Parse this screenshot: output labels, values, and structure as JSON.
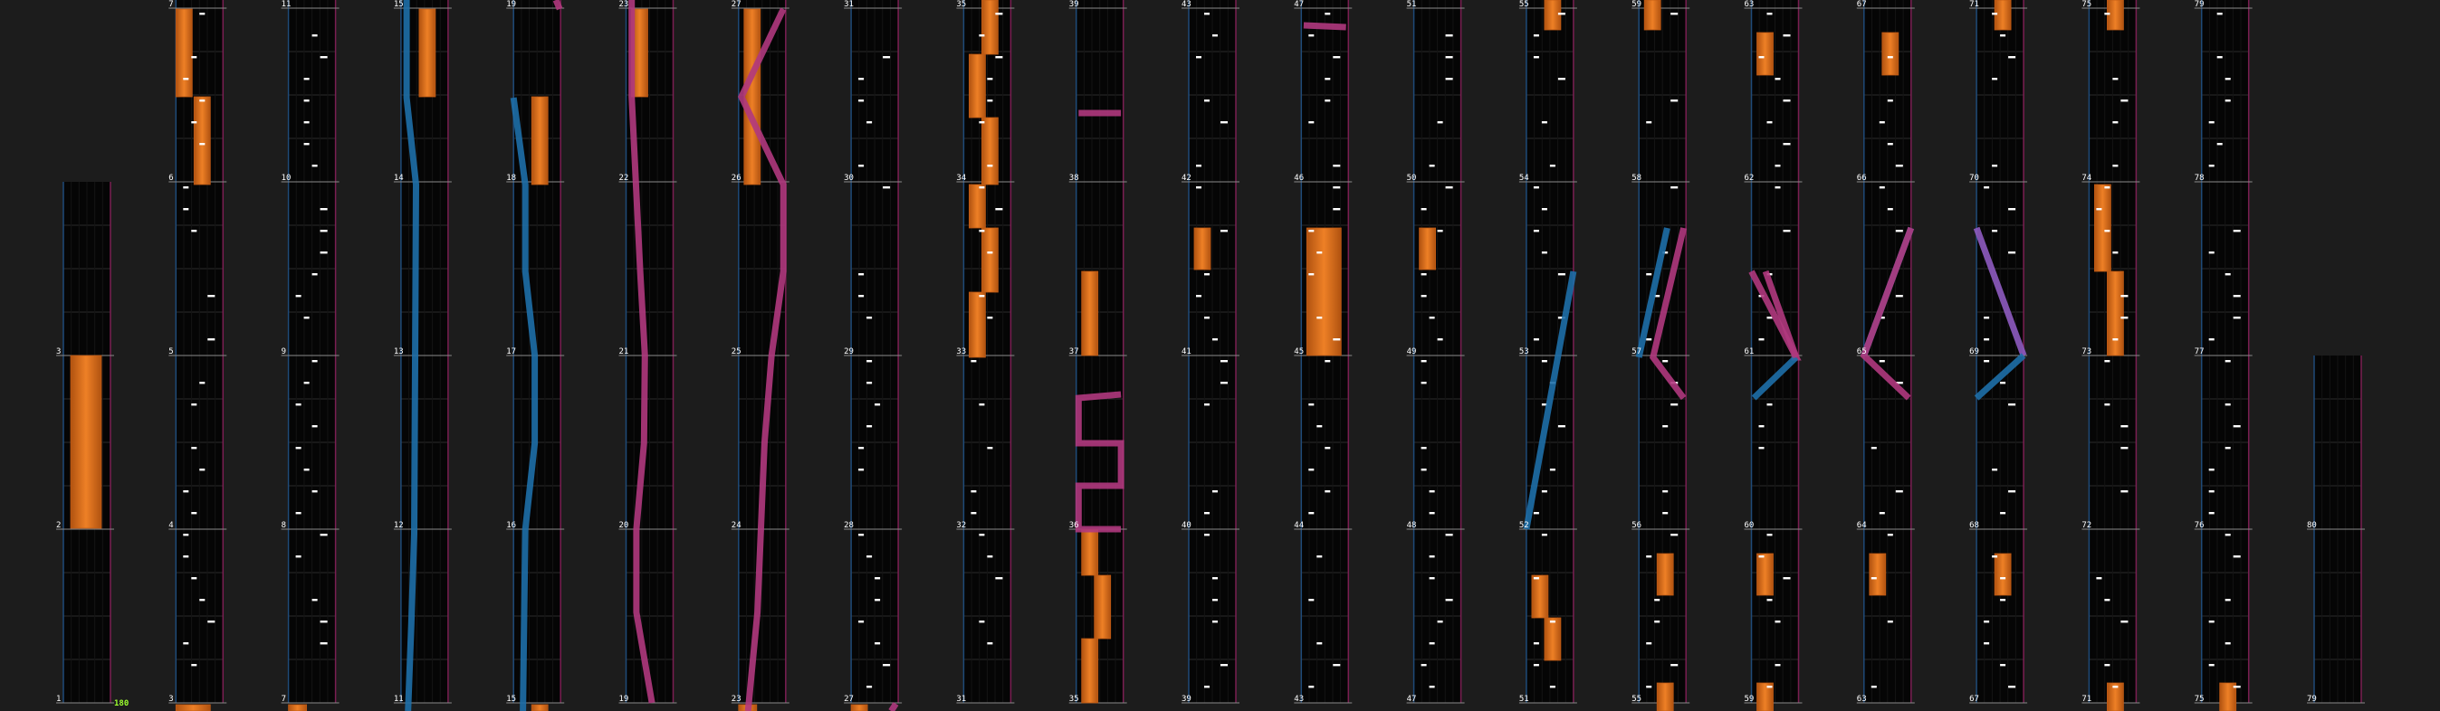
{
  "bpm_label": "180",
  "colors": {
    "background": "#1c1c1c",
    "lane_bg": "#050505",
    "lane_grid": "#2c2c2c",
    "left_edge": "#1e4a78",
    "right_edge": "#7a1e52",
    "measure_line": "#8a8a8a",
    "chip_note": "#ffffff",
    "hold_orange": "#e8741e",
    "laser_left": "#1e6fa8",
    "laser_right": "#b0387e",
    "bpm_text": "#9cff2e"
  },
  "measures": [
    {
      "n": 1,
      "col": 0,
      "row": 0
    },
    {
      "n": 2,
      "col": 0,
      "row": 1
    },
    {
      "n": 3,
      "col": 0,
      "row": 2
    },
    {
      "n": 3,
      "col": 1,
      "row": 0
    },
    {
      "n": 4,
      "col": 1,
      "row": 1
    },
    {
      "n": 5,
      "col": 1,
      "row": 2
    },
    {
      "n": 6,
      "col": 1,
      "row": 3
    },
    {
      "n": 7,
      "col": 1,
      "row": 4
    },
    {
      "n": 7,
      "col": 2,
      "row": 0
    },
    {
      "n": 8,
      "col": 2,
      "row": 1
    },
    {
      "n": 9,
      "col": 2,
      "row": 2
    },
    {
      "n": 10,
      "col": 2,
      "row": 3
    },
    {
      "n": 11,
      "col": 2,
      "row": 4
    },
    {
      "n": 11,
      "col": 3,
      "row": 0
    },
    {
      "n": 12,
      "col": 3,
      "row": 1
    },
    {
      "n": 13,
      "col": 3,
      "row": 2
    },
    {
      "n": 14,
      "col": 3,
      "row": 3
    },
    {
      "n": 15,
      "col": 3,
      "row": 4
    },
    {
      "n": 15,
      "col": 4,
      "row": 0
    },
    {
      "n": 16,
      "col": 4,
      "row": 1
    },
    {
      "n": 17,
      "col": 4,
      "row": 2
    },
    {
      "n": 18,
      "col": 4,
      "row": 3
    },
    {
      "n": 19,
      "col": 4,
      "row": 4
    },
    {
      "n": 19,
      "col": 5,
      "row": 0
    },
    {
      "n": 20,
      "col": 5,
      "row": 1
    },
    {
      "n": 21,
      "col": 5,
      "row": 2
    },
    {
      "n": 22,
      "col": 5,
      "row": 3
    },
    {
      "n": 23,
      "col": 5,
      "row": 4
    },
    {
      "n": 23,
      "col": 6,
      "row": 0
    },
    {
      "n": 24,
      "col": 6,
      "row": 1
    },
    {
      "n": 25,
      "col": 6,
      "row": 2
    },
    {
      "n": 26,
      "col": 6,
      "row": 3
    },
    {
      "n": 27,
      "col": 6,
      "row": 4
    },
    {
      "n": 27,
      "col": 7,
      "row": 0
    },
    {
      "n": 28,
      "col": 7,
      "row": 1
    },
    {
      "n": 29,
      "col": 7,
      "row": 2
    },
    {
      "n": 30,
      "col": 7,
      "row": 3
    },
    {
      "n": 31,
      "col": 7,
      "row": 4
    },
    {
      "n": 31,
      "col": 8,
      "row": 0
    },
    {
      "n": 32,
      "col": 8,
      "row": 1
    },
    {
      "n": 33,
      "col": 8,
      "row": 2
    },
    {
      "n": 34,
      "col": 8,
      "row": 3
    },
    {
      "n": 35,
      "col": 8,
      "row": 4
    },
    {
      "n": 35,
      "col": 9,
      "row": 0
    },
    {
      "n": 36,
      "col": 9,
      "row": 1
    },
    {
      "n": 37,
      "col": 9,
      "row": 2
    },
    {
      "n": 38,
      "col": 9,
      "row": 3
    },
    {
      "n": 39,
      "col": 9,
      "row": 4
    },
    {
      "n": 39,
      "col": 10,
      "row": 0
    },
    {
      "n": 40,
      "col": 10,
      "row": 1
    },
    {
      "n": 41,
      "col": 10,
      "row": 2
    },
    {
      "n": 42,
      "col": 10,
      "row": 3
    },
    {
      "n": 43,
      "col": 10,
      "row": 4
    },
    {
      "n": 43,
      "col": 11,
      "row": 0
    },
    {
      "n": 44,
      "col": 11,
      "row": 1
    },
    {
      "n": 45,
      "col": 11,
      "row": 2
    },
    {
      "n": 46,
      "col": 11,
      "row": 3
    },
    {
      "n": 47,
      "col": 11,
      "row": 4
    },
    {
      "n": 47,
      "col": 12,
      "row": 0
    },
    {
      "n": 48,
      "col": 12,
      "row": 1
    },
    {
      "n": 49,
      "col": 12,
      "row": 2
    },
    {
      "n": 50,
      "col": 12,
      "row": 3
    },
    {
      "n": 51,
      "col": 12,
      "row": 4
    },
    {
      "n": 51,
      "col": 13,
      "row": 0
    },
    {
      "n": 52,
      "col": 13,
      "row": 1
    },
    {
      "n": 53,
      "col": 13,
      "row": 2
    },
    {
      "n": 54,
      "col": 13,
      "row": 3
    },
    {
      "n": 55,
      "col": 13,
      "row": 4
    },
    {
      "n": 55,
      "col": 14,
      "row": 0
    },
    {
      "n": 56,
      "col": 14,
      "row": 1
    },
    {
      "n": 57,
      "col": 14,
      "row": 2
    },
    {
      "n": 58,
      "col": 14,
      "row": 3
    },
    {
      "n": 59,
      "col": 14,
      "row": 4
    },
    {
      "n": 59,
      "col": 15,
      "row": 0
    },
    {
      "n": 60,
      "col": 15,
      "row": 1
    },
    {
      "n": 61,
      "col": 15,
      "row": 2
    },
    {
      "n": 62,
      "col": 15,
      "row": 3
    },
    {
      "n": 63,
      "col": 15,
      "row": 4
    },
    {
      "n": 63,
      "col": 16,
      "row": 0
    },
    {
      "n": 64,
      "col": 16,
      "row": 1
    },
    {
      "n": 65,
      "col": 16,
      "row": 2
    },
    {
      "n": 66,
      "col": 16,
      "row": 3
    },
    {
      "n": 67,
      "col": 16,
      "row": 4
    },
    {
      "n": 67,
      "col": 17,
      "row": 0
    },
    {
      "n": 68,
      "col": 17,
      "row": 1
    },
    {
      "n": 69,
      "col": 17,
      "row": 2
    },
    {
      "n": 70,
      "col": 17,
      "row": 3
    },
    {
      "n": 71,
      "col": 17,
      "row": 4
    },
    {
      "n": 71,
      "col": 18,
      "row": 0
    },
    {
      "n": 72,
      "col": 18,
      "row": 1
    },
    {
      "n": 73,
      "col": 18,
      "row": 2
    },
    {
      "n": 74,
      "col": 18,
      "row": 3
    },
    {
      "n": 75,
      "col": 18,
      "row": 4
    },
    {
      "n": 75,
      "col": 19,
      "row": 0
    },
    {
      "n": 76,
      "col": 19,
      "row": 1
    },
    {
      "n": 77,
      "col": 19,
      "row": 2
    },
    {
      "n": 78,
      "col": 19,
      "row": 3
    },
    {
      "n": 79,
      "col": 19,
      "row": 4
    },
    {
      "n": 79,
      "col": 20,
      "row": 0
    },
    {
      "n": 80,
      "col": 20,
      "row": 1
    }
  ]
}
